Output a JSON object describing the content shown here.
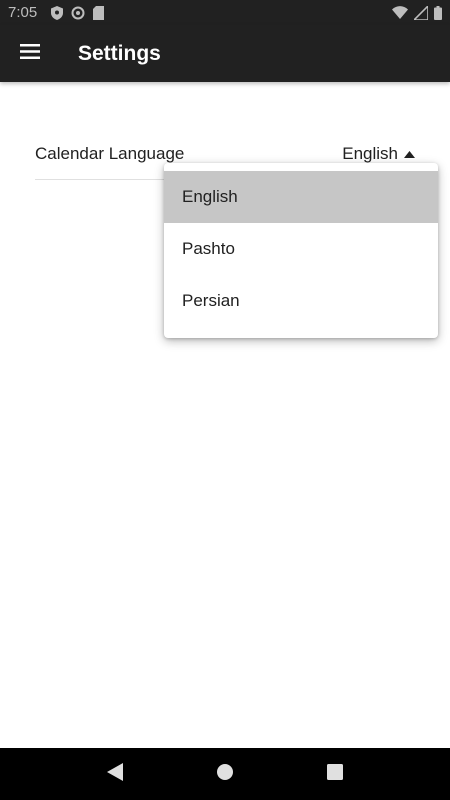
{
  "status_bar": {
    "time": "7:05",
    "left_icons": [
      "shield-icon",
      "sync-icon",
      "sd-card-icon"
    ],
    "right_icons": [
      "wifi-icon",
      "signal-icon",
      "battery-icon"
    ]
  },
  "app_bar": {
    "title": "Settings",
    "menu_icon": "hamburger-menu-icon",
    "background": "#212121"
  },
  "settings": {
    "calendar_language": {
      "label": "Calendar Language",
      "selected": "English"
    }
  },
  "dropdown": {
    "options": [
      {
        "label": "English",
        "selected": true
      },
      {
        "label": "Pashto",
        "selected": false
      },
      {
        "label": "Persian",
        "selected": false
      }
    ],
    "selected_color": "#c6c6c6"
  },
  "nav_bar": {
    "buttons": [
      "back-icon",
      "home-icon",
      "recents-icon"
    ]
  }
}
